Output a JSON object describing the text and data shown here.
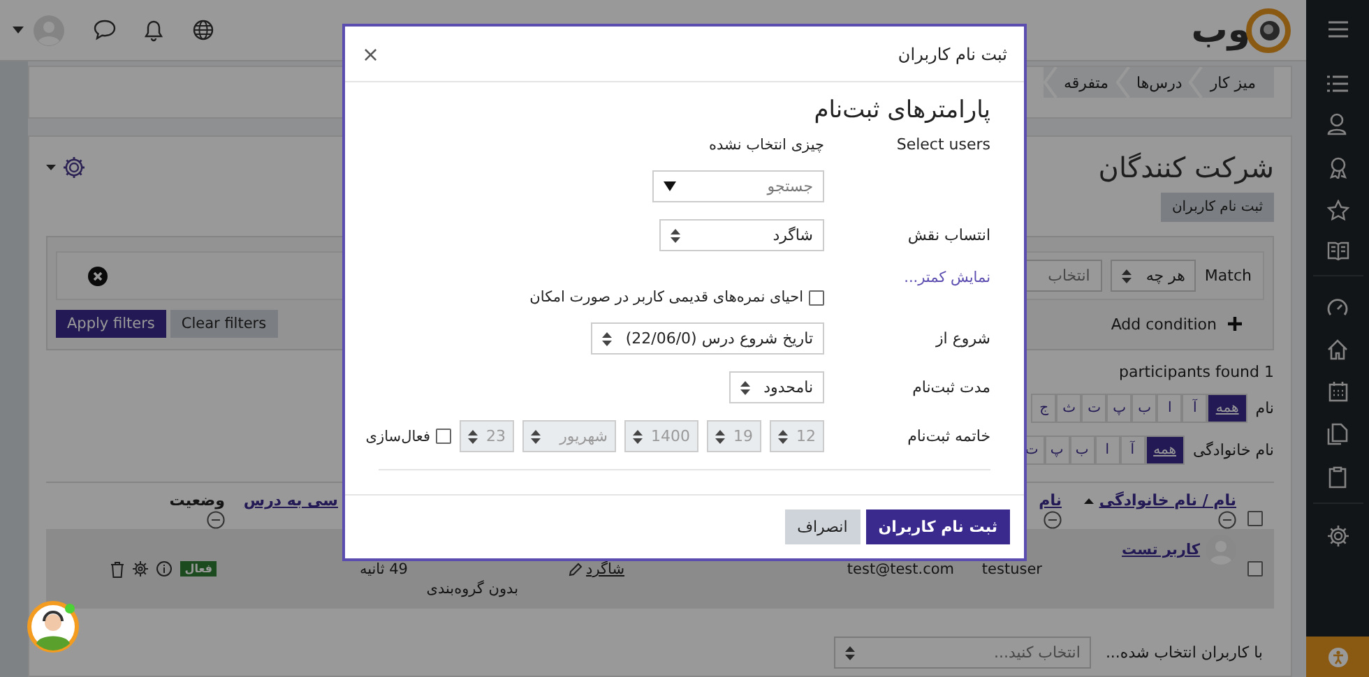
{
  "top_bar": {
    "logo": "وب"
  },
  "breadcrumb": [
    {
      "label": "میز کار"
    },
    {
      "label": "درس‌ها"
    },
    {
      "label": "متفرقه"
    }
  ],
  "page_title": "شرکت کنندگان",
  "enrol_button": "ثبت نام کاربران",
  "filters": {
    "match_label": "Match",
    "match_value": "هر چه",
    "type_placeholder": "انتخاب",
    "add_condition": "Add condition",
    "apply_button": "Apply filters",
    "clear_button": "Clear filters"
  },
  "participants_found": "participants found 1",
  "initials_bars": [
    {
      "label": "نام",
      "letters": [
        {
          "text": "همه",
          "selected": true
        },
        {
          "text": "آ",
          "selected": false
        },
        {
          "text": "ا",
          "selected": false
        },
        {
          "text": "ب",
          "selected": false
        },
        {
          "text": "پ",
          "selected": false
        },
        {
          "text": "ت",
          "selected": false
        },
        {
          "text": "ث",
          "selected": false
        },
        {
          "text": "ج",
          "selected": false
        }
      ]
    },
    {
      "label": "نام خانوادگی",
      "letters": [
        {
          "text": "همه",
          "selected": true
        },
        {
          "text": "آ",
          "selected": false
        },
        {
          "text": "ا",
          "selected": false
        },
        {
          "text": "ب",
          "selected": false
        },
        {
          "text": "پ",
          "selected": false
        },
        {
          "text": "ت",
          "selected": false
        }
      ]
    }
  ],
  "table": {
    "select_all_checked": false,
    "columns": [
      {
        "label": "نام / نام خانوادگی",
        "kind": "sorted"
      },
      {
        "label": "نام",
        "kind": "collapsible"
      },
      {
        "label": "سی به درس",
        "kind": "plain"
      },
      {
        "label": "وضعیت",
        "kind": "collapsible"
      }
    ],
    "rows": [
      {
        "checked": false,
        "full_name": "کاربر تست",
        "username": "testuser",
        "email": "test@test.com",
        "role": "شاگرد",
        "group": "بدون گروه‌بندی",
        "last_access": "49 ثانیه",
        "status": "فعال"
      }
    ]
  },
  "bulk_action": {
    "label": "با کاربران انتخاب شده...",
    "placeholder": "انتخاب کنید..."
  },
  "dialog": {
    "title": "ثبت نام کاربران",
    "close": "×",
    "heading": "پارامترهای ثبت‌نام",
    "select_users": {
      "label": "Select users",
      "value": "چیزی انتخاب نشده",
      "search_placeholder": "جستجو"
    },
    "role": {
      "label": "انتساب نقش",
      "value": "شاگرد"
    },
    "show_less": "نمایش کمتر...",
    "recover_grades": {
      "label": "احیای نمره‌های قدیمی کاربر در صورت امکان",
      "checked": false
    },
    "start": {
      "label": "شروع از",
      "value": "تاریخ شروع درس (22/06/0)"
    },
    "duration": {
      "label": "مدت ثبت‌نام",
      "value": "نامحدود"
    },
    "end": {
      "label": "خاتمه ثبت‌نام",
      "enabled": false,
      "fields": [
        "12",
        "19",
        "1400",
        "شهریور",
        "23"
      ],
      "enable_label": "فعال‌سازی"
    },
    "buttons": [
      {
        "label": "ثبت نام کاربران",
        "kind": "primary"
      },
      {
        "label": "انصراف",
        "kind": "secondary"
      }
    ]
  }
}
